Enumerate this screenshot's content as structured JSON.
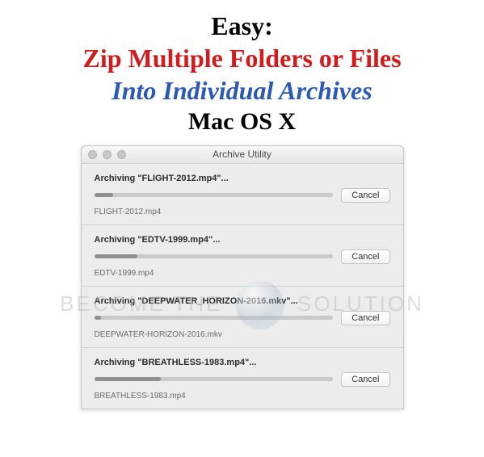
{
  "heading": {
    "line1": "Easy:",
    "line2": "Zip Multiple Folders or Files",
    "line3": "Into Individual Archives",
    "line4": "Mac OS X"
  },
  "window": {
    "title": "Archive Utility",
    "items": [
      {
        "label": "Archiving \"FLIGHT-2012.mp4\"...",
        "filename": "FLIGHT-2012.mp4",
        "progress_pct": 8,
        "cancel": "Cancel"
      },
      {
        "label": "Archiving \"EDTV-1999.mp4\"...",
        "filename": "EDTV-1999.mp4",
        "progress_pct": 18,
        "cancel": "Cancel"
      },
      {
        "label": "Archiving \"DEEPWATER_HORIZON-2016.mkv\"...",
        "filename": "DEEPWATER-HORIZON-2016.mkv",
        "progress_pct": 3,
        "cancel": "Cancel"
      },
      {
        "label": "Archiving \"BREATHLESS-1983.mp4\"...",
        "filename": "BREATHLESS-1983.mp4",
        "progress_pct": 28,
        "cancel": "Cancel"
      }
    ]
  },
  "watermark": {
    "left": "Become The",
    "right": "Solution"
  }
}
